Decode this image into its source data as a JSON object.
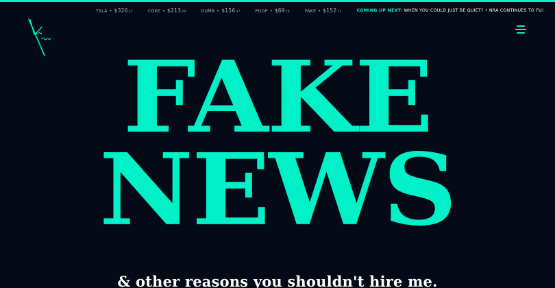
{
  "colors": {
    "background": "#050b16",
    "accent": "#00f0c8",
    "text": "#ffffff",
    "muted": "#a9b2bd"
  },
  "header": {
    "logo_icon": "signature-k-logo-icon",
    "menu_icon": "hamburger-menu-icon",
    "ticker": {
      "stocks": [
        {
          "symbol": "TSLA",
          "dot": "•",
          "price": "$326",
          "cents": "37"
        },
        {
          "symbol": "COKE",
          "dot": "•",
          "price": "$213",
          "cents": "29"
        },
        {
          "symbol": "DUMB",
          "dot": "•",
          "price": "$156",
          "cents": "47"
        },
        {
          "symbol": "POOP",
          "dot": "•",
          "price": "$69",
          "cents": "74"
        },
        {
          "symbol": "FAKE",
          "dot": "•",
          "price": "$152",
          "cents": "71"
        }
      ],
      "coming_up_label": "COMING UP NEXT:",
      "coming_up_text": "WHEN YOU COULD JUST BE QUIET? • NRA CONTINUES TO FU!"
    }
  },
  "hero": {
    "line1": "FAKE",
    "line2": "NEWS",
    "tagline": "& other reasons you shouldn't hire me."
  }
}
